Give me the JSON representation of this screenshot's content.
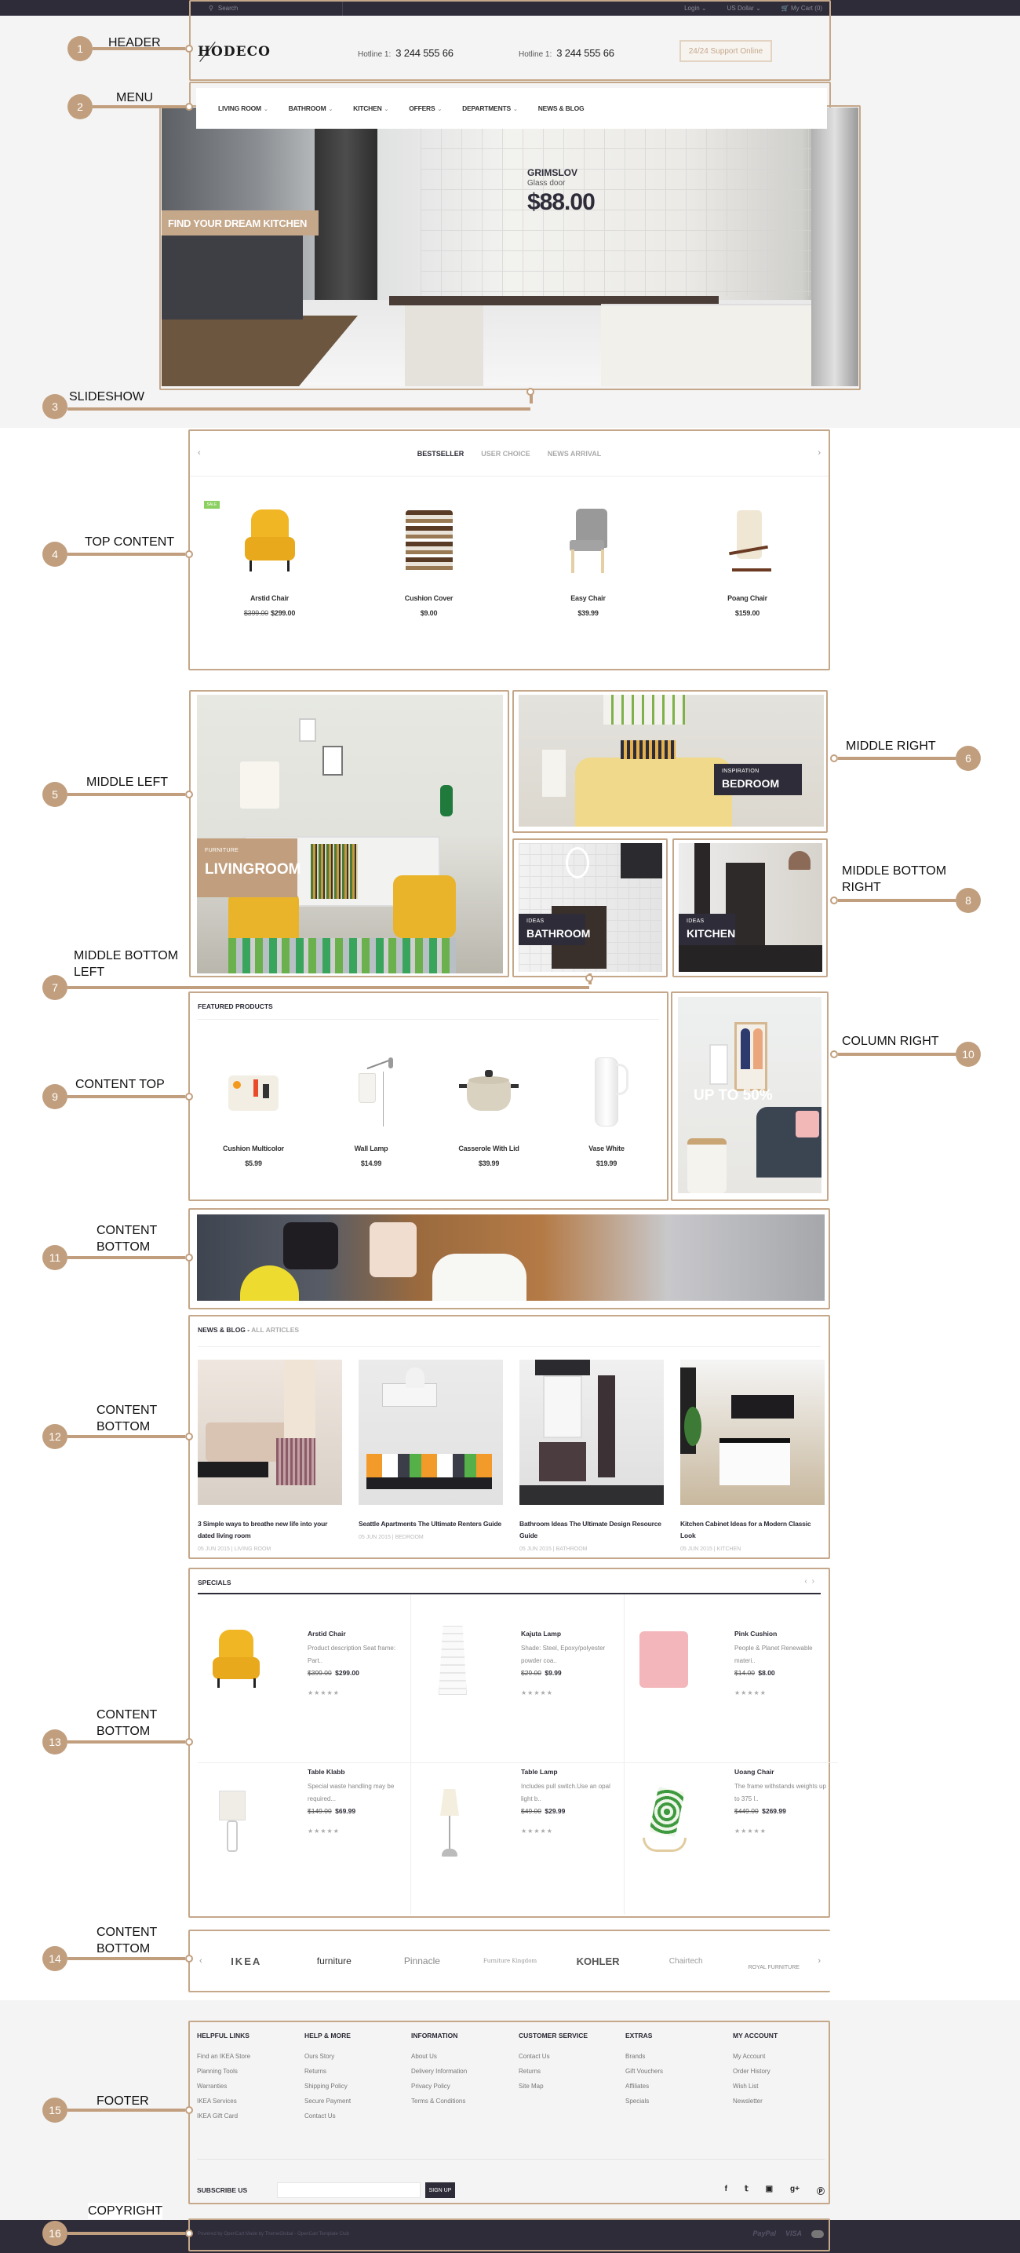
{
  "colors": {
    "accent": "#c19f7e",
    "dark": "#2e2c39",
    "sale": "#8bd060",
    "background": "#f4f4f4"
  },
  "topbar": {
    "search_placeholder": "Search",
    "login": "Login",
    "currency": "US Dollar",
    "cart": "My Cart (0)"
  },
  "header": {
    "logo": "HODECO",
    "hotlines": [
      {
        "label": "Hotline 1:",
        "number": "3 244 555 66"
      },
      {
        "label": "Hotline 1:",
        "number": "3 244 555 66"
      }
    ],
    "support_button": "24/24 Support Online"
  },
  "menu": {
    "items": [
      {
        "label": "LIVING ROOM",
        "has_dropdown": true
      },
      {
        "label": "BATHROOM",
        "has_dropdown": true
      },
      {
        "label": "KITCHEN",
        "has_dropdown": true
      },
      {
        "label": "OFFERS",
        "has_dropdown": true
      },
      {
        "label": "DEPARTMENTS",
        "has_dropdown": true
      },
      {
        "label": "NEWS & BLOG",
        "has_dropdown": false
      }
    ]
  },
  "slideshow": {
    "tagline": "FIND YOUR DREAM KITCHEN",
    "product_name": "GRIMSLOV",
    "product_sub": "Glass door",
    "product_price": "$88.00"
  },
  "annotations": [
    {
      "num": "1",
      "label": "HEADER"
    },
    {
      "num": "2",
      "label": "MENU"
    },
    {
      "num": "3",
      "label": "SLIDESHOW"
    },
    {
      "num": "4",
      "label": "TOP CONTENT"
    },
    {
      "num": "5",
      "label": "MIDDLE LEFT"
    },
    {
      "num": "6",
      "label": "MIDDLE RIGHT"
    },
    {
      "num": "7",
      "label": "MIDDLE BOTTOM LEFT"
    },
    {
      "num": "8",
      "label": "MIDDLE BOTTOM RIGHT"
    },
    {
      "num": "9",
      "label": "CONTENT TOP"
    },
    {
      "num": "10",
      "label": "COLUMN RIGHT"
    },
    {
      "num": "11",
      "label": "CONTENT BOTTOM"
    },
    {
      "num": "12",
      "label": "CONTENT BOTTOM"
    },
    {
      "num": "13",
      "label": "CONTENT BOTTOM"
    },
    {
      "num": "14",
      "label": "CONTENT BOTTOM"
    },
    {
      "num": "15",
      "label": "FOOTER"
    },
    {
      "num": "16",
      "label": "COPYRIGHT"
    }
  ],
  "top_content": {
    "tabs": [
      "BESTSELLER",
      "USER CHOICE",
      "NEWS ARRIVAL"
    ],
    "active_tab": "BESTSELLER",
    "sale_badge": "SALE",
    "products": [
      {
        "name": "Arstid Chair",
        "old_price": "$399.00",
        "price": "$299.00"
      },
      {
        "name": "Cushion Cover",
        "old_price": "",
        "price": "$9.00"
      },
      {
        "name": "Easy Chair",
        "old_price": "",
        "price": "$39.99"
      },
      {
        "name": "Poang Chair",
        "old_price": "",
        "price": "$159.00"
      }
    ]
  },
  "middle": {
    "livingroom": {
      "small": "FURNITURE",
      "big": "LIVINGROOM"
    },
    "bedroom": {
      "small": "INSPIRATION",
      "big": "BEDROOM"
    },
    "bathroom": {
      "small": "IDEAS",
      "big": "BATHROOM"
    },
    "kitchen": {
      "small": "IDEAS",
      "big": "KITCHEN"
    }
  },
  "featured": {
    "title": "FEATURED PRODUCTS",
    "products": [
      {
        "name": "Cushion Multicolor",
        "price": "$5.99"
      },
      {
        "name": "Wall Lamp",
        "price": "$14.99"
      },
      {
        "name": "Casserole With Lid",
        "price": "$39.99"
      },
      {
        "name": "Vase White",
        "price": "$19.99"
      }
    ]
  },
  "column_right": {
    "promo": "UP TO 50%"
  },
  "blog": {
    "title": "NEWS & BLOG",
    "link": "ALL ARTICLES",
    "separator": " - ",
    "items": [
      {
        "title": "3 Simple ways to breathe new life into your dated living room",
        "meta": "05 JUN 2015 | LIVING ROOM"
      },
      {
        "title": "Seattle Apartments The Ultimate Renters Guide",
        "meta": "05 JUN 2015 | BEDROOM"
      },
      {
        "title": "Bathroom Ideas The Ultimate Design Resource Guide",
        "meta": "05 JUN 2015 | BATHROOM"
      },
      {
        "title": "Kitchen Cabinet Ideas for a Modern Classic Look",
        "meta": "05 JUN 2015 | KITCHEN"
      }
    ]
  },
  "specials": {
    "title": "SPECIALS",
    "rating_stars": "★★★★★",
    "items": [
      {
        "name": "Arstid Chair",
        "desc": "Product description Seat frame: Part..",
        "old_price": "$399.00",
        "price": "$299.00"
      },
      {
        "name": "Kajuta Lamp",
        "desc": "Shade: Steel, Epoxy/polyester powder coa..",
        "old_price": "$29.00",
        "price": "$9.99"
      },
      {
        "name": "Pink Cushion",
        "desc": "People & Planet Renewable materi..",
        "old_price": "$14.00",
        "price": "$8.00"
      },
      {
        "name": "Table Klabb",
        "desc": "Special waste handling may be required...",
        "old_price": "$149.00",
        "price": "$69.99"
      },
      {
        "name": "Table Lamp",
        "desc": "Includes pull switch.Use an opal light b..",
        "old_price": "$49.00",
        "price": "$29.99"
      },
      {
        "name": "Uoang Chair",
        "desc": "The frame withstands weights up to 375 l..",
        "old_price": "$449.00",
        "price": "$269.99"
      }
    ]
  },
  "brands": [
    "IKEA",
    "furniture",
    "Pinnacle",
    "Furniture Kingdom",
    "KOHLER",
    "Chairtech",
    "ROYAL FURNITURE"
  ],
  "footer": {
    "columns": [
      {
        "title": "HELPFUL LINKS",
        "links": [
          "Find an IKEA Store",
          "Planning Tools",
          "Warranties",
          "IKEA Services",
          "IKEA Gift Card"
        ]
      },
      {
        "title": "HELP & MORE",
        "links": [
          "Ours Story",
          "Returns",
          "Shipping Policy",
          "Secure Payment",
          "Contact Us"
        ]
      },
      {
        "title": "INFORMATION",
        "links": [
          "About Us",
          "Delivery Information",
          "Privacy Policy",
          "Terms & Conditions"
        ]
      },
      {
        "title": "CUSTOMER SERVICE",
        "links": [
          "Contact Us",
          "Returns",
          "Site Map"
        ]
      },
      {
        "title": "EXTRAS",
        "links": [
          "Brands",
          "Gift Vouchers",
          "Affiliates",
          "Specials"
        ]
      },
      {
        "title": "MY ACCOUNT",
        "links": [
          "My Account",
          "Order History",
          "Wish List",
          "Newsletter"
        ]
      }
    ],
    "subscribe_label": "SUBSCRIBE US",
    "subscribe_value": "",
    "signup_button": "SIGN UP",
    "social": [
      "facebook",
      "twitter",
      "instagram",
      "google-plus",
      "pinterest"
    ]
  },
  "copyright": {
    "text": "Powered by OpenCart Made by ThemeGlobal - OpenCart Template Club",
    "payments": [
      "PayPal",
      "VISA",
      "MasterCard"
    ]
  }
}
